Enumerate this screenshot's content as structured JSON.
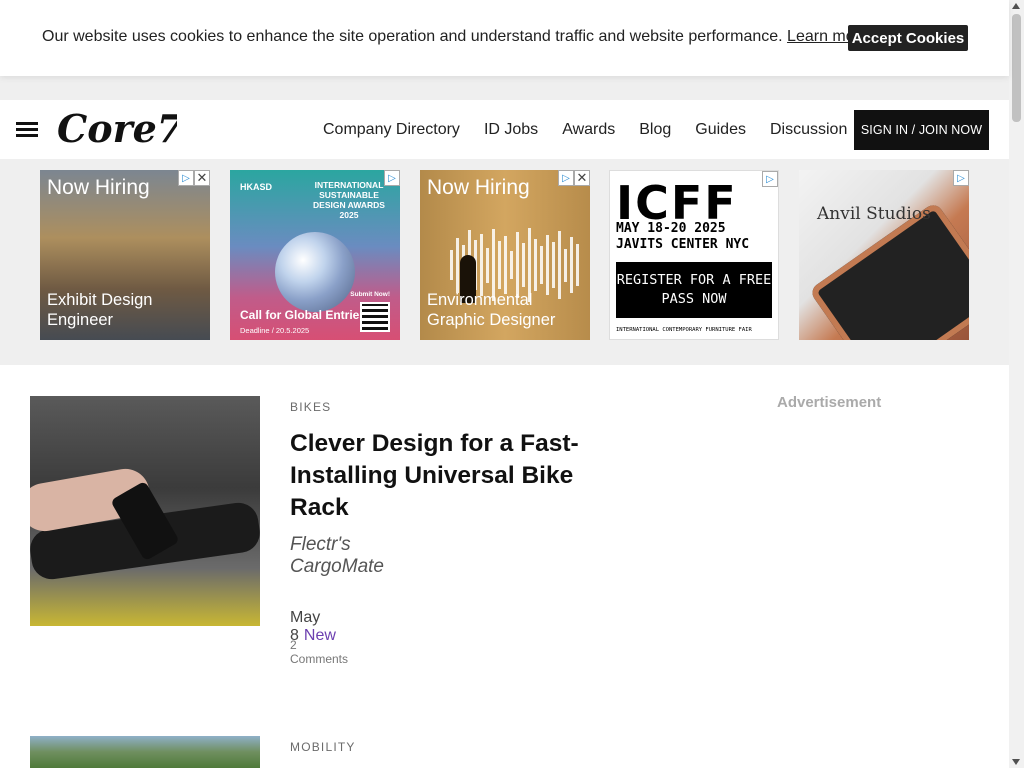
{
  "cookie_banner": {
    "text": "Our website uses cookies to enhance the site operation and understand traffic and website performance.",
    "link_label": "Learn more.",
    "accept_label": "Accept Cookies"
  },
  "header": {
    "logo_text": "Core77",
    "nav_items": [
      "Company Directory",
      "ID Jobs",
      "Awards",
      "Blog",
      "Guides",
      "Discussion"
    ],
    "signin_label": "SIGN IN / JOIN NOW"
  },
  "ads": [
    {
      "hire": "Now Hiring",
      "role": "Exhibit Design Engineer"
    },
    {
      "logo": "HKASD",
      "title": "INTERNATIONAL SUSTAINABLE DESIGN AWARDS 2025",
      "call": "Call for Global Entries",
      "deadline": "Deadline / 20.5.2025",
      "submit": "Submit Now!"
    },
    {
      "hire": "Now Hiring",
      "role": "Environmental Graphic Designer"
    },
    {
      "big": "ICFF",
      "date": "MAY 18-20 2025 JAVITS CENTER NYC",
      "register": "REGISTER FOR A FREE PASS NOW",
      "small": "INTERNATIONAL CONTEMPORARY FURNITURE FAIR"
    },
    {
      "brand": "Anvil Studios"
    }
  ],
  "articles": [
    {
      "category": "BIKES",
      "title": "Clever Design for a Fast-Installing Universal Bike Rack",
      "subtitle": "Flectr's CargoMate",
      "date": "May 8",
      "tag": "New",
      "comments": "2 Comments"
    },
    {
      "category": "MOBILITY"
    }
  ],
  "sidebar": {
    "ad_label": "Advertisement"
  },
  "colors": {
    "accent_tag": "#6c3fb0",
    "dark_button": "#111111",
    "band_bg": "#efefef"
  }
}
